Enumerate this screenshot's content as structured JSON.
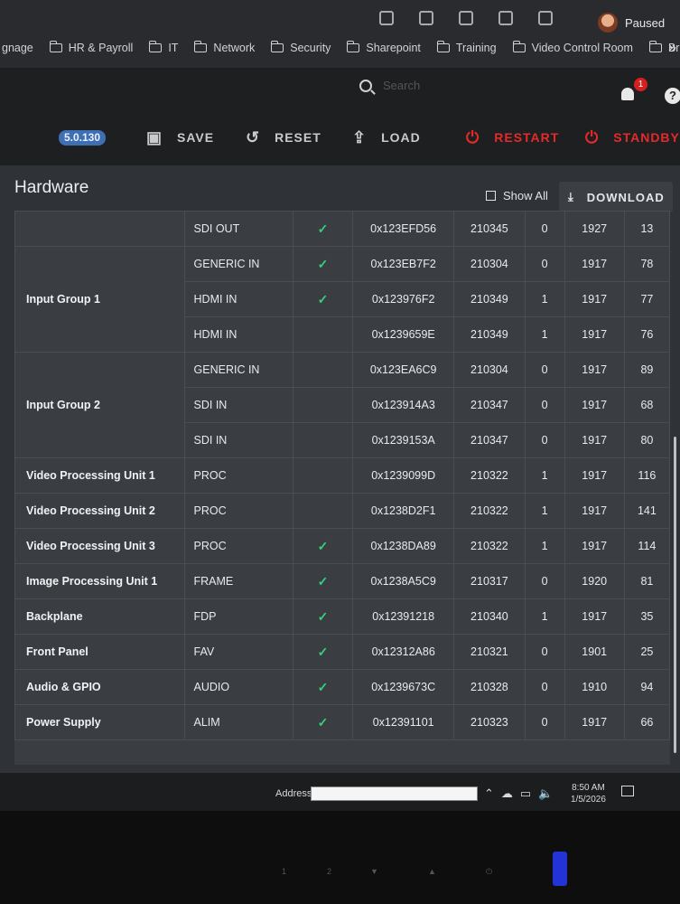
{
  "browser": {
    "profile": "Paused",
    "bookmarks": [
      "gnage",
      "HR & Payroll",
      "IT",
      "Network",
      "Security",
      "Sharepoint",
      "Training",
      "Video Control Room",
      "Bronco"
    ],
    "overflow": "»"
  },
  "header": {
    "search_placeholder": "Search",
    "notifications": "1",
    "help": "?"
  },
  "toolbar": {
    "version": "5.0.130",
    "save": "SAVE",
    "reset": "RESET",
    "load": "LOAD",
    "restart": "RESTART",
    "standby": "STANDBY"
  },
  "panel": {
    "title": "Hardware",
    "show_all": "Show All",
    "download": "DOWNLOAD"
  },
  "rows": [
    {
      "group": "",
      "type": "SDI OUT",
      "ok": true,
      "id": "0x123EFD56",
      "part": "210345",
      "rev": "0",
      "year": "1927",
      "temp": "13"
    },
    {
      "group": "Input Group 1",
      "type": "GENERIC IN",
      "ok": true,
      "id": "0x123EB7F2",
      "part": "210304",
      "rev": "0",
      "year": "1917",
      "temp": "78"
    },
    {
      "group": "",
      "type": "HDMI IN",
      "ok": true,
      "id": "0x123976F2",
      "part": "210349",
      "rev": "1",
      "year": "1917",
      "temp": "77"
    },
    {
      "group": "",
      "type": "HDMI IN",
      "ok": false,
      "id": "0x1239659E",
      "part": "210349",
      "rev": "1",
      "year": "1917",
      "temp": "76"
    },
    {
      "group": "Input Group 2",
      "type": "GENERIC IN",
      "ok": false,
      "id": "0x123EA6C9",
      "part": "210304",
      "rev": "0",
      "year": "1917",
      "temp": "89"
    },
    {
      "group": "",
      "type": "SDI IN",
      "ok": false,
      "id": "0x123914A3",
      "part": "210347",
      "rev": "0",
      "year": "1917",
      "temp": "68"
    },
    {
      "group": "",
      "type": "SDI IN",
      "ok": false,
      "id": "0x1239153A",
      "part": "210347",
      "rev": "0",
      "year": "1917",
      "temp": "80"
    },
    {
      "group": "Video Processing Unit 1",
      "type": "PROC",
      "ok": false,
      "id": "0x1239099D",
      "part": "210322",
      "rev": "1",
      "year": "1917",
      "temp": "116"
    },
    {
      "group": "Video Processing Unit 2",
      "type": "PROC",
      "ok": false,
      "id": "0x1238D2F1",
      "part": "210322",
      "rev": "1",
      "year": "1917",
      "temp": "141"
    },
    {
      "group": "Video Processing Unit 3",
      "type": "PROC",
      "ok": true,
      "id": "0x1238DA89",
      "part": "210322",
      "rev": "1",
      "year": "1917",
      "temp": "114"
    },
    {
      "group": "Image Processing Unit 1",
      "type": "FRAME",
      "ok": true,
      "id": "0x1238A5C9",
      "part": "210317",
      "rev": "0",
      "year": "1920",
      "temp": "81"
    },
    {
      "group": "Backplane",
      "type": "FDP",
      "ok": true,
      "id": "0x12391218",
      "part": "210340",
      "rev": "1",
      "year": "1917",
      "temp": "35"
    },
    {
      "group": "Front Panel",
      "type": "FAV",
      "ok": true,
      "id": "0x12312A86",
      "part": "210321",
      "rev": "0",
      "year": "1901",
      "temp": "25"
    },
    {
      "group": "Audio & GPIO",
      "type": "AUDIO",
      "ok": true,
      "id": "0x1239673C",
      "part": "210328",
      "rev": "0",
      "year": "1910",
      "temp": "94"
    },
    {
      "group": "Power Supply",
      "type": "ALIM",
      "ok": true,
      "id": "0x12391101",
      "part": "210323",
      "rev": "0",
      "year": "1917",
      "temp": "66"
    }
  ],
  "check_glyph": "✓",
  "taskbar": {
    "address_label": "Address",
    "time": "8:50 AM",
    "date": "1/5/2026"
  },
  "bezel": {
    "buttons": [
      "1",
      "2",
      "▼",
      "▲",
      "⏻"
    ]
  }
}
